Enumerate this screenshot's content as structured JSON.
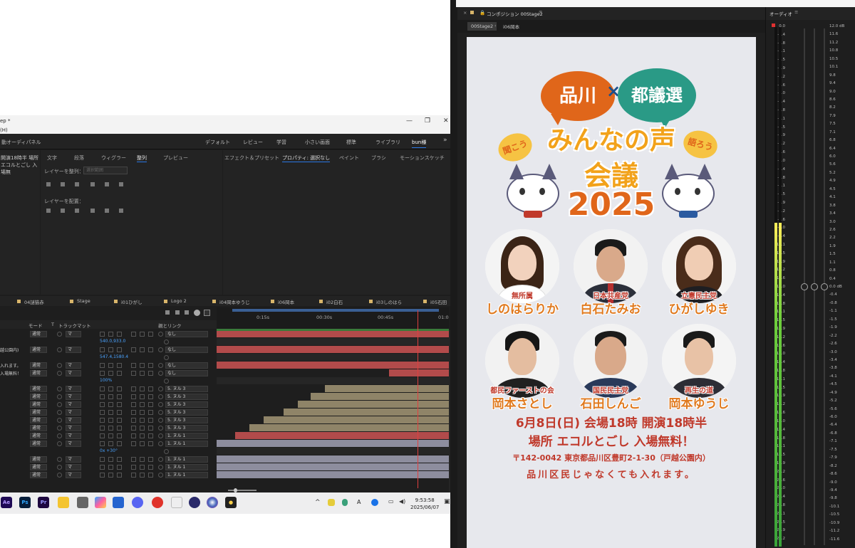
{
  "ae": {
    "title_fragment": "ep *",
    "menu_fragment": "(H)",
    "left_panel_label": "動オーディパネル",
    "workspaces": [
      "デフォルト",
      "レビュー",
      "学習",
      "小さい画面",
      "標準",
      "ライブラリ",
      "bun様"
    ],
    "project_text_line1": "開演18時半 場所",
    "project_text_line2": "エコルとごし 入場無",
    "align_tabs": [
      "文字",
      "段落",
      "ウィグラー",
      "整列",
      "プレビュー"
    ],
    "align_label": "レイヤーを整列：",
    "align_dropdown": "選択範囲",
    "distribute_label": "レイヤーを配置：",
    "effects_tabs": [
      "エフェクト＆プリセット",
      "プロパティ: 選択なし",
      "ペイント",
      "ブラシ",
      "モーションスケッチ"
    ]
  },
  "timeline": {
    "tabs": [
      "04謎猫赤",
      "Stage",
      "i01ひがし",
      "Logo 2",
      "i04岡本ゆうじ",
      "i06岡本",
      "i02白石",
      "i03しのはら",
      "i05石田"
    ],
    "headers": [
      "モード",
      "T",
      "トラックマット",
      "親とリンク"
    ],
    "ruler_ticks": [
      "0:15s",
      "00:30s",
      "00:45s",
      "01:0"
    ],
    "rows": [
      {
        "label": "",
        "mode": "通常",
        "matte": "マ",
        "parent": "なし",
        "value": ""
      },
      {
        "label": "",
        "mode": "",
        "matte": "",
        "parent": "",
        "value": "540.0,933.0"
      },
      {
        "label": "越公園内)",
        "mode": "通常",
        "matte": "マ",
        "parent": "なし",
        "value": ""
      },
      {
        "label": "",
        "mode": "",
        "matte": "",
        "parent": "",
        "value": "547.4,1580.4"
      },
      {
        "label": "入れます。",
        "mode": "通常",
        "matte": "マ",
        "parent": "なし",
        "value": ""
      },
      {
        "label": "入場無料！",
        "mode": "通常",
        "matte": "マ",
        "parent": "なし",
        "value": ""
      },
      {
        "label": "",
        "mode": "",
        "matte": "",
        "parent": "",
        "value": "100%"
      },
      {
        "label": "",
        "mode": "通常",
        "matte": "マ",
        "parent": "5. ヌル 3",
        "value": ""
      },
      {
        "label": "",
        "mode": "通常",
        "matte": "マ",
        "parent": "5. ヌル 3",
        "value": ""
      },
      {
        "label": "",
        "mode": "通常",
        "matte": "マ",
        "parent": "5. ヌル 3",
        "value": ""
      },
      {
        "label": "",
        "mode": "通常",
        "matte": "マ",
        "parent": "5. ヌル 3",
        "value": ""
      },
      {
        "label": "",
        "mode": "通常",
        "matte": "マ",
        "parent": "5. ヌル 3",
        "value": ""
      },
      {
        "label": "",
        "mode": "通常",
        "matte": "マ",
        "parent": "5. ヌル 3",
        "value": ""
      },
      {
        "label": "",
        "mode": "通常",
        "matte": "マ",
        "parent": "1. ヌル 1",
        "value": ""
      },
      {
        "label": "",
        "mode": "通常",
        "matte": "マ",
        "parent": "1. ヌル 1",
        "value": ""
      },
      {
        "label": "",
        "mode": "",
        "matte": "",
        "parent": "",
        "value": "0x +30°"
      },
      {
        "label": "",
        "mode": "通常",
        "matte": "マ",
        "parent": "1. ヌル 1",
        "value": ""
      },
      {
        "label": "",
        "mode": "通常",
        "matte": "マ",
        "parent": "1. ヌル 1",
        "value": ""
      },
      {
        "label": "",
        "mode": "通常",
        "matte": "マ",
        "parent": "1. ヌル 1",
        "value": ""
      }
    ]
  },
  "taskbar": {
    "apps": [
      "Ae",
      "Ps",
      "Pr"
    ],
    "time": "9:53:58",
    "date": "2025/06/07",
    "ime": "A"
  },
  "comp": {
    "header": "コンポジション 00Stage2",
    "crumb_active": "00Stage2",
    "crumb_next": "i06岡本"
  },
  "poster": {
    "bubble_left": "品川",
    "bubble_x": "×",
    "bubble_right": "都議選",
    "side_left": "聞こう",
    "side_right": "語ろう",
    "title1": "みんなの声",
    "title2": "会議",
    "year": "2025",
    "candidates": [
      {
        "party": "無所属",
        "name": "しのはらりか"
      },
      {
        "party": "日本共産党",
        "name": "白石たみお"
      },
      {
        "party": "立憲民主党",
        "name": "ひがしゆき"
      },
      {
        "party": "都民ファーストの会",
        "name": "岡本さとし"
      },
      {
        "party": "国民民主党",
        "name": "石田しんご"
      },
      {
        "party": "再生の道",
        "name": "岡本ゆうじ"
      }
    ],
    "date_line": "6月8日(日) 会場18時 開演18時半",
    "venue_line": "場所 エコルとごし 入場無料！",
    "address_line": "〒142-0042 東京都品川区豊町2-1-30（戸越公園内）",
    "note_line": "品川区民じゃなくても入れます。"
  },
  "audio": {
    "header": "オーディオ",
    "left_scale": [
      "0.0",
      "-0.4",
      "-0.8",
      "-1.1",
      "-1.5",
      "-1.9",
      "-2.2",
      "-2.6",
      "-3.0",
      "-3.4",
      "-3.8",
      "-4.1",
      "-4.5",
      "-4.9",
      "-5.2",
      "-5.6",
      "-6.0",
      "-6.4",
      "-6.8",
      "-7.1",
      "-7.5",
      "-7.9",
      "-8.2",
      "-8.6",
      "-9.0",
      "-9.4",
      "-10.1",
      "-10.5",
      "-10.9",
      "-11.2",
      "-11.6",
      "-12.0",
      "-12.4",
      "-12.8",
      "-13.1",
      "-13.5",
      "-13.9",
      "-14.2",
      "-14.6",
      "-15.0",
      "-15.4",
      "-15.8",
      "-16.1",
      "-16.5",
      "-16.9",
      "-17.2",
      "-17.6",
      "-18.0",
      "-18.4",
      "-18.8",
      "-19.1",
      "-19.5",
      "-19.9",
      "-20.2",
      "-20.6",
      "-21.0",
      "-21.4",
      "-21.8",
      "-22.1",
      "-22.5",
      "-22.9",
      "-23.2"
    ],
    "right_scale": [
      "12.0 dB",
      "11.6",
      "11.2",
      "10.8",
      "10.5",
      "10.1",
      "9.8",
      "9.4",
      "9.0",
      "8.6",
      "8.2",
      "7.9",
      "7.5",
      "7.1",
      "6.8",
      "6.4",
      "6.0",
      "5.6",
      "5.2",
      "4.9",
      "4.5",
      "4.1",
      "3.8",
      "3.4",
      "3.0",
      "2.6",
      "2.2",
      "1.9",
      "1.5",
      "1.1",
      "0.8",
      "0.4",
      "0.0 dB",
      "-0.4",
      "-0.8",
      "-1.1",
      "-1.5",
      "-1.9",
      "-2.2",
      "-2.6",
      "-3.0",
      "-3.4",
      "-3.8",
      "-4.1",
      "-4.5",
      "-4.9",
      "-5.2",
      "-5.6",
      "-6.0",
      "-6.4",
      "-6.8",
      "-7.1",
      "-7.5",
      "-7.9",
      "-8.2",
      "-8.6",
      "-9.0",
      "-9.4",
      "-9.8",
      "-10.1",
      "-10.5",
      "-10.9",
      "-11.2",
      "-11.6"
    ]
  }
}
